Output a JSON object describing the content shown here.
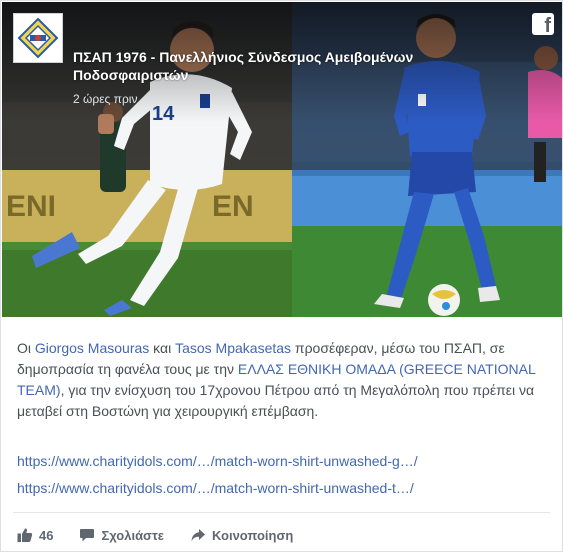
{
  "post": {
    "page_name": "ΠΣΑΠ 1976 - Πανελλήνιος Σύνδεσμος Αμειβομένων Ποδοσφαιριστών",
    "timestamp": "2 ώρες πριν",
    "logo_icon": "psap-logo-icon",
    "platform_icon": "facebook-icon",
    "images": [
      {
        "icon": "footballer-photo-white-kit",
        "jersey_number": "14"
      },
      {
        "icon": "footballer-photo-blue-kit"
      }
    ],
    "text": {
      "p1": "Οι ",
      "mention1": "Giorgos Masouras",
      "p2": " και ",
      "mention2": "Tasos Mpakasetas",
      "p3": " προσέφεραν, μέσω του ΠΣΑΠ, σε δημοπρασία τη φανέλα τους με την ",
      "mention3": "ΕΛΛΑΣ ΕΘΝΙΚΗ ΟΜΑΔΑ (GREECE NATIONAL TEAM)",
      "p4": ", για την ενίσχυση του 17χρονου Πέτρου από τη Μεγαλόπολη που πρέπει να μεταβεί στη Βοστώνη για χειρουργική επέμβαση."
    },
    "links": [
      "https://www.charityidols.com/…/match-worn-shirt-unwashed-g…/",
      "https://www.charityidols.com/…/match-worn-shirt-unwashed-t…/"
    ]
  },
  "actions": {
    "likes_count": "46",
    "comment_label": "Σχολιάστε",
    "share_label": "Κοινοποίηση"
  },
  "colors": {
    "link": "#4267b2",
    "text": "#4b4f56",
    "action_text": "#606770"
  }
}
